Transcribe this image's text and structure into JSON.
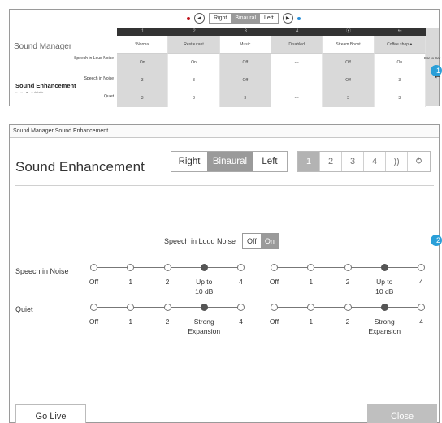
{
  "panel1": {
    "controls": {
      "right": "Right",
      "binaural": "Binaural",
      "left": "Left"
    },
    "title": "Sound Manager",
    "program_numbers": [
      "1",
      "2",
      "3",
      "4",
      "⦿",
      "⇆"
    ],
    "program_names": [
      "*Normal",
      "Restaurant",
      "Music",
      "Disabled",
      "Stream Boost",
      "Coffee shop ●"
    ],
    "ear_to_ear": "Ear to Ear",
    "swap_icon": "⇄",
    "section_title": "Sound Enhancement",
    "section_sub": "○—○—●—○  details",
    "row_labels": [
      "Speech in Loud Noise",
      "Speech in Noise",
      "Quiet"
    ],
    "rows": [
      [
        "On",
        "On",
        "Off",
        "---",
        "Off",
        "On"
      ],
      [
        "3",
        "3",
        "Off",
        "---",
        "Off",
        "3"
      ],
      [
        "3",
        "3",
        "3",
        "---",
        "3",
        "3"
      ]
    ],
    "badge": "1"
  },
  "panel2": {
    "window_title": "Sound Manager Sound Enhancement",
    "header": "Sound Enhancement",
    "side_seg": {
      "right": "Right",
      "binaural": "Binaural",
      "left": "Left"
    },
    "programs": [
      "1",
      "2",
      "3",
      "4",
      "))",
      "⥁"
    ],
    "speech_loud_label": "Speech in Loud Noise",
    "toggle": {
      "off": "Off",
      "on": "On"
    },
    "badge": "2",
    "speech_noise_label": "Speech in Noise",
    "quiet_label": "Quiet",
    "noise_ticks": [
      "Off",
      "1",
      "2",
      "Up to\n10 dB",
      "4"
    ],
    "quiet_ticks": [
      "Off",
      "1",
      "2",
      "Strong\nExpansion",
      "4"
    ],
    "noise_level": 3,
    "quiet_level": 3,
    "go_live": "Go Live",
    "close": "Close"
  }
}
